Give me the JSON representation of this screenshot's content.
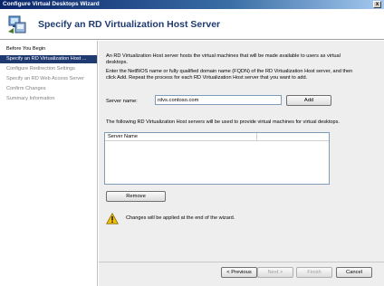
{
  "window": {
    "title": "Configure Virtual Desktops Wizard",
    "close_glyph": "x"
  },
  "header": {
    "title": "Specify an RD Virtualization Host Server"
  },
  "nav": {
    "items": [
      {
        "label": "Before You Begin"
      },
      {
        "label": "Specify an RD Virtualization Host ..."
      },
      {
        "label": "Configure Redirection Settings"
      },
      {
        "label": "Specify an RD Web Access Server"
      },
      {
        "label": "Confirm Changes"
      },
      {
        "label": "Summary Information"
      }
    ]
  },
  "main": {
    "intro": "An RD Virtualization Host server hosts the virtual machines that will be made available to users as virtual desktops.",
    "instructions": "Enter the NetBIOS name or fully qualified domain name (FQDN) of the RD Virtualization Host server, and then click Add. Repeat the process for each RD Virtualization Host server that you want to add.",
    "server_label": "Server name:",
    "server_value": "rdvs.contoso.com",
    "add_label": "Add",
    "list_intro": "The following RD Virtualization Host servers will be used to provide virtual machines for virtual desktops.",
    "list_header": "Server Name",
    "remove_label": "Remove",
    "warning": "Changes will be applied at the end of the wizard."
  },
  "footer": {
    "previous_label": "< Previous",
    "next_label": "Next >",
    "finish_label": "Finish",
    "cancel_label": "Cancel"
  },
  "colors": {
    "accent": "#1f3a70",
    "titlebar": "#0a246a",
    "warning": "#f2c200"
  },
  "icons": {
    "wizard": "computer-wizard-icon",
    "warning": "warning-icon"
  }
}
